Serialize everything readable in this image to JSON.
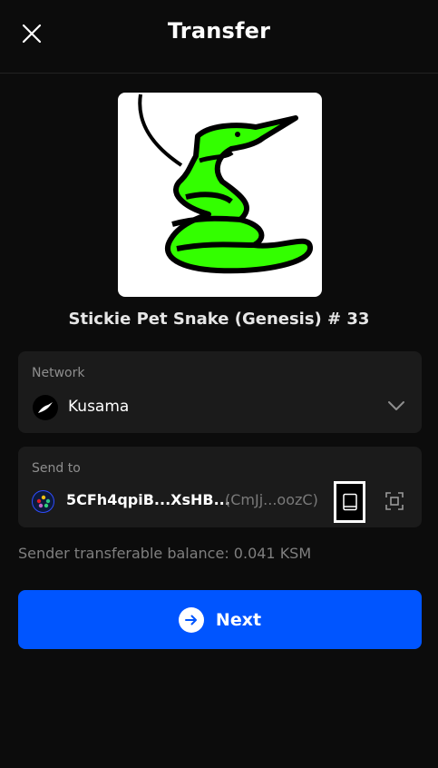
{
  "header": {
    "title": "Transfer",
    "close_icon": "close-icon"
  },
  "nft": {
    "name": "Stickie Pet Snake (Genesis) # 33",
    "image": "green-snake-drawing"
  },
  "network": {
    "label": "Network",
    "value": "Kusama",
    "icon": "kusama-bird-icon",
    "dropdown_icon": "chevron-down-icon"
  },
  "send_to": {
    "label": "Send to",
    "address": "5CFh4qpiB...XsHB...",
    "alias": "(CmJj...oozC)",
    "address_book_icon": "address-book-icon",
    "scan_icon": "scan-qr-icon"
  },
  "balance": {
    "text": "Sender transferable balance: 0.041 KSM"
  },
  "actions": {
    "next_label": "Next",
    "next_icon": "arrow-right-icon"
  },
  "colors": {
    "background": "#0c0c0c",
    "card": "#1b1b1b",
    "accent": "#0055ff",
    "snake": "#33ff00"
  }
}
